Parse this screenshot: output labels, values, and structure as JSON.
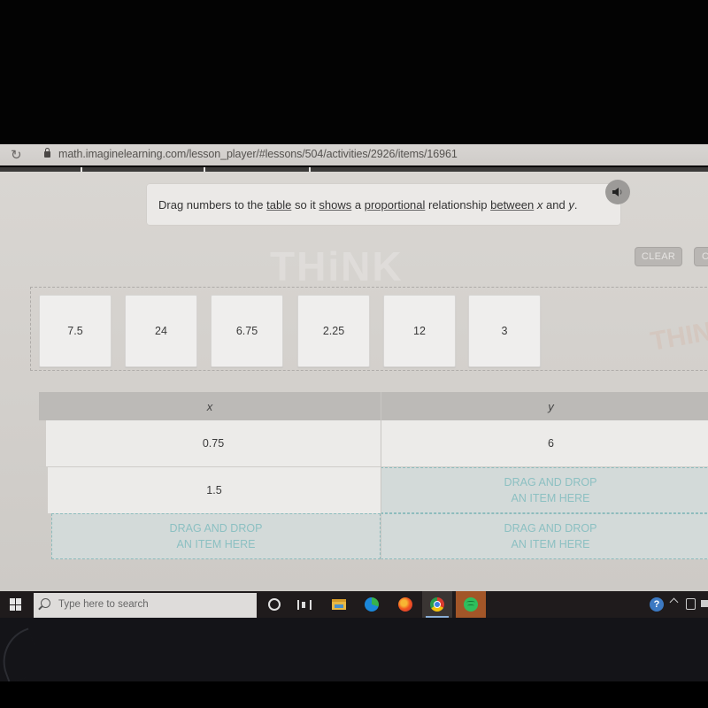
{
  "browser": {
    "url": "math.imaginelearning.com/lesson_player/#lessons/504/activities/2926/items/16961",
    "progress_segments": 4
  },
  "instruction": {
    "parts": [
      {
        "text": "Drag numbers to the ",
        "style": "plain"
      },
      {
        "text": "table",
        "style": "underline"
      },
      {
        "text": " so it ",
        "style": "plain"
      },
      {
        "text": "shows",
        "style": "underline"
      },
      {
        "text": " a ",
        "style": "plain"
      },
      {
        "text": "proportional",
        "style": "underline"
      },
      {
        "text": " relationship ",
        "style": "plain"
      },
      {
        "text": "between",
        "style": "underline"
      },
      {
        "text": " ",
        "style": "plain"
      },
      {
        "text": "x",
        "style": "italic"
      },
      {
        "text": " and ",
        "style": "plain"
      },
      {
        "text": "y",
        "style": "italic"
      },
      {
        "text": ".",
        "style": "plain"
      }
    ],
    "audio_icon": "speaker-icon"
  },
  "buttons": {
    "clear": "CLEAR",
    "check_partial": "C"
  },
  "watermark": "THiNK",
  "tiles": [
    "7.5",
    "24",
    "6.75",
    "2.25",
    "12",
    "3"
  ],
  "table": {
    "headers": [
      "x",
      "y"
    ],
    "rows": [
      {
        "x": "0.75",
        "y": "6"
      },
      {
        "x": "1.5",
        "y": null
      },
      {
        "x": null,
        "y": null
      }
    ],
    "drop_placeholder_line1": "DRAG AND DROP",
    "drop_placeholder_line2": "AN ITEM HERE"
  },
  "taskbar": {
    "search_placeholder": "Type here to search",
    "apps": [
      "cortana",
      "task-view",
      "file-explorer",
      "edge",
      "firefox",
      "chrome",
      "spotify"
    ],
    "tray": [
      "help",
      "show-hidden-icons",
      "meet-now",
      "battery"
    ]
  }
}
